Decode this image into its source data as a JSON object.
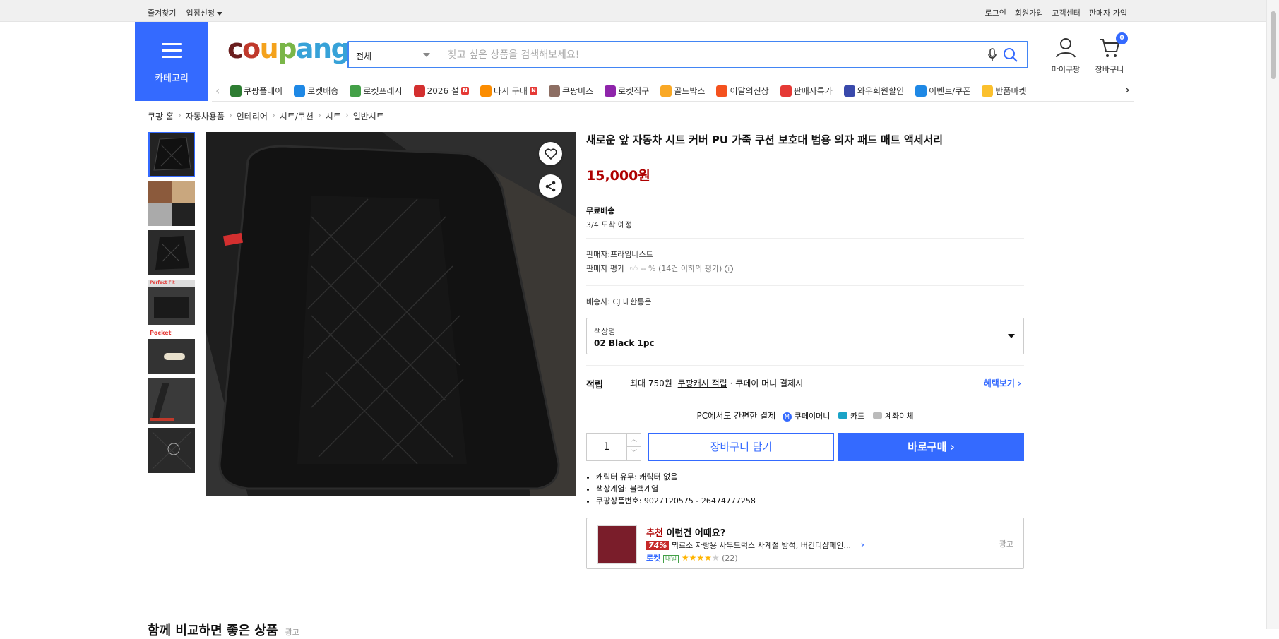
{
  "topbar": {
    "left": [
      "즐겨찾기",
      "입점신청"
    ],
    "right": [
      "로그인",
      "회원가입",
      "고객센터",
      "판매자 가입"
    ]
  },
  "category_button": "카테고리",
  "logo": "coupang",
  "search": {
    "scope": "전체",
    "placeholder": "찾고 싶은 상품을 검색해보세요!"
  },
  "header_icons": {
    "mycoupang": "마이쿠팡",
    "cart": "장바구니",
    "cart_count": "0"
  },
  "category_nav": [
    {
      "label": "쿠팡플레이",
      "icon": "play-icon",
      "color": "#2e7d32",
      "badge": ""
    },
    {
      "label": "로켓배송",
      "icon": "rocket-icon",
      "color": "#1e88e5",
      "badge": ""
    },
    {
      "label": "로켓프레시",
      "icon": "rocket-fresh-icon",
      "color": "#43a047",
      "badge": ""
    },
    {
      "label": "2026 설",
      "icon": "gift-icon",
      "color": "#d32f2f",
      "badge": "N"
    },
    {
      "label": "다시 구매",
      "icon": "repurchase-icon",
      "color": "#fb8c00",
      "badge": "N"
    },
    {
      "label": "쿠팡비즈",
      "icon": "biz-icon",
      "color": "#8d6e63",
      "badge": ""
    },
    {
      "label": "로켓직구",
      "icon": "globe-icon",
      "color": "#8e24aa",
      "badge": ""
    },
    {
      "label": "골드박스",
      "icon": "goldbox-icon",
      "color": "#f9a825",
      "badge": ""
    },
    {
      "label": "이달의신상",
      "icon": "new-icon",
      "color": "#f4511e",
      "badge": ""
    },
    {
      "label": "판매자특가",
      "icon": "percent-icon",
      "color": "#e53935",
      "badge": ""
    },
    {
      "label": "와우회원할인",
      "icon": "wow-icon",
      "color": "#3949ab",
      "badge": ""
    },
    {
      "label": "이벤트/쿠폰",
      "icon": "coupon-icon",
      "color": "#1e88e5",
      "badge": ""
    },
    {
      "label": "반품마켓",
      "icon": "market-icon",
      "color": "#fbc02d",
      "badge": ""
    }
  ],
  "breadcrumb": [
    "쿠팡 홈",
    "자동차용품",
    "인테리어",
    "시트/쿠션",
    "시트",
    "일반시트"
  ],
  "thumbnails": [
    {
      "label": ""
    },
    {
      "label": ""
    },
    {
      "label": ""
    },
    {
      "label": "Perfect Fit"
    },
    {
      "label": "Pocket"
    },
    {
      "label": ""
    },
    {
      "label": ""
    }
  ],
  "product": {
    "title": "새로운 앞 자동차 시트 커버 PU 가죽 쿠션 보호대 범용 의자 패드 매트 액세서리",
    "price": "15,000원",
    "shipping_label": "무료배송",
    "arrival": "3/4 도착 예정",
    "seller": "판매자:프라임네스트",
    "seller_rating_label": "판매자 평가",
    "seller_rating_value": "-- %",
    "seller_rating_note": "(14건 이하의 평가)",
    "carrier": "배송사:  CJ 대한통운",
    "option_label": "색상명",
    "option_value": "02 Black 1pc",
    "reward_label": "적립",
    "reward_prefix": "최대 750원",
    "reward_link": "쿠팡캐시 적립",
    "reward_suffix": "· 쿠페이 머니 결제시",
    "benefit_link": "혜택보기",
    "pay_title": "PC에서도 간편한 결제",
    "pay_methods": [
      "쿠페이머니",
      "카드",
      "계좌이체"
    ],
    "quantity": "1",
    "cart_button": "장바구니 담기",
    "buy_button": "바로구매",
    "specs": [
      "캐릭터 유무: 캐릭터 없음",
      "색상계열: 블랙계열",
      "쿠팡상품번호: 9027120575 - 26474777258"
    ]
  },
  "recommend": {
    "title_accent": "추천",
    "title_rest": " 이런건 어때요?",
    "discount": "74%",
    "name": "뫼르소 자랑용 사무드럭스 사계절 방석, 버건디샴페인...",
    "badge_rocket": "로켓",
    "badge_day": "내일",
    "rating": 4,
    "reviews": "(22)",
    "ad": "광고"
  },
  "compare_heading": "함께 비교하면 좋은 상품",
  "compare_ad": "광고",
  "colors": {
    "accent": "#346aff",
    "price": "#ae0000"
  }
}
